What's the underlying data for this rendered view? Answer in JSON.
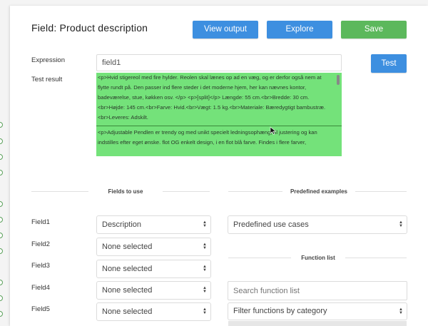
{
  "header": {
    "title": "Field: Product description",
    "view_output": "View output",
    "explore": "Explore",
    "save": "Save"
  },
  "expression": {
    "label": "Expression",
    "value": "field1",
    "test_button": "Test"
  },
  "test_result": {
    "label": "Test result",
    "block1": "<p>Hvid stigereol med fire hylder. Reolen skal lænes op ad en væg, og er derfor også nem at flytte rundt på. Den passer ind flere steder i det moderne hjem, her kan nævnes kontor, badeværelse, stue, køkken osv. </p> <p>[split]</p> Længde: 55 cm.<br>Bredde: 30 cm.<br>Højde: 145 cm.<br>Farve: Hvid.<br>Vægt: 1.5 kg.<br>Materiale: Bæredygtigt bambustræ.<br>Leveres: Adskilt.",
    "block2": "<p>Adjustable Pendlen er trendy og med unikt specielt ledningsophæng, til justering og kan indstilles efter eget ønske. flot OG enkelt design, i en flot blå farve. Findes i flere farver,"
  },
  "fields_to_use": {
    "heading": "Fields to use",
    "rows": [
      {
        "label": "Field1",
        "value": "Description"
      },
      {
        "label": "Field2",
        "value": "None selected"
      },
      {
        "label": "Field3",
        "value": "None selected"
      },
      {
        "label": "Field4",
        "value": "None selected"
      },
      {
        "label": "Field5",
        "value": "None selected"
      }
    ]
  },
  "predefined": {
    "heading": "Predefined examples",
    "select_value": "Predefined use cases"
  },
  "function_list": {
    "heading": "Function list",
    "search_placeholder": "Search function list",
    "filter_value": "Filter functions by category"
  },
  "colors": {
    "blue_button": "#3d8fe0",
    "green_button": "#5cb85c",
    "result_bg": "#74e27a"
  }
}
